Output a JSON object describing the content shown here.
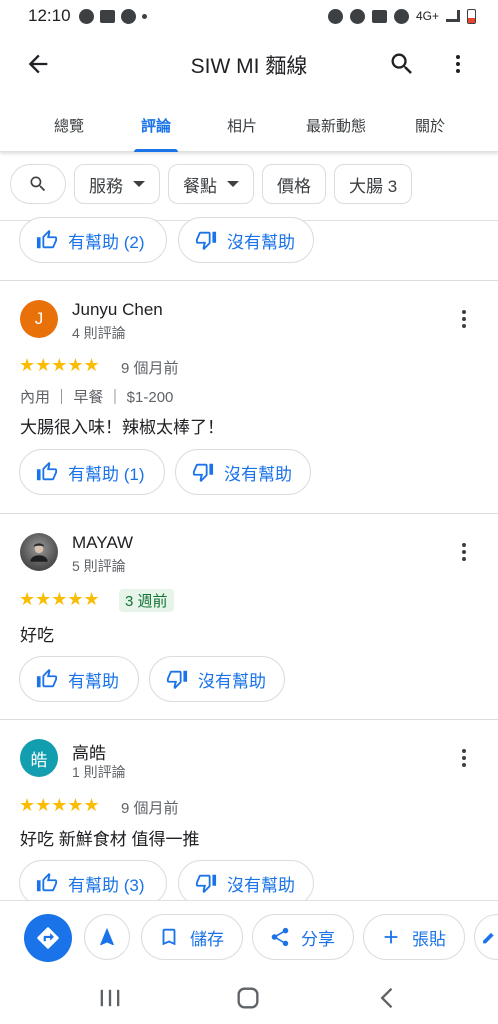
{
  "status_bar": {
    "time": "12:10",
    "network": "4G+"
  },
  "app_bar": {
    "title": "SIW MI 麵線"
  },
  "tabs": [
    {
      "label": "總覽",
      "active": false
    },
    {
      "label": "評論",
      "active": true
    },
    {
      "label": "相片",
      "active": false
    },
    {
      "label": "最新動態",
      "active": false
    },
    {
      "label": "關於",
      "active": false
    }
  ],
  "filters": [
    {
      "label": "服務",
      "dropdown": true
    },
    {
      "label": "餐點",
      "dropdown": true
    },
    {
      "label": "價格",
      "dropdown": false
    },
    {
      "label": "大腸 3",
      "dropdown": false
    }
  ],
  "top_partial": {
    "helpful_label": "有幫助 (2)",
    "not_helpful_label": "沒有幫助"
  },
  "reviews": [
    {
      "avatar_letter": "J",
      "avatar_color": "#e8710a",
      "name": "Junyu Chen",
      "count": "4 則評論",
      "stars": 5,
      "time": "9 個月前",
      "meta": "內用 ｜ 早餐 ｜ $1-200",
      "text": "大腸很入味！辣椒太棒了！",
      "helpful_label": "有幫助 (1)",
      "not_helpful_label": "沒有幫助"
    },
    {
      "avatar_letter": "",
      "avatar_color": "#6d6d6d",
      "name": "MAYAW",
      "count": "5 則評論",
      "stars": 5,
      "time": "3 週前",
      "text": "好吃",
      "helpful_label": "有幫助",
      "not_helpful_label": "沒有幫助"
    },
    {
      "avatar_letter": "皓",
      "avatar_color": "#129eaf",
      "name": "高皓",
      "count": "1 則評論",
      "stars": 5,
      "time": "9 個月前",
      "text": "好吃 新鮮食材 值得一推",
      "helpful_label": "有幫助 (3)",
      "not_helpful_label": "沒有幫助"
    }
  ],
  "bottom_actions": {
    "save": "儲存",
    "share": "分享",
    "post": "張貼"
  },
  "colors": {
    "accent": "#1a73e8",
    "star": "#fbbc04",
    "recent_badge_bg": "#e6f4ea",
    "recent_badge_text": "#137333"
  }
}
